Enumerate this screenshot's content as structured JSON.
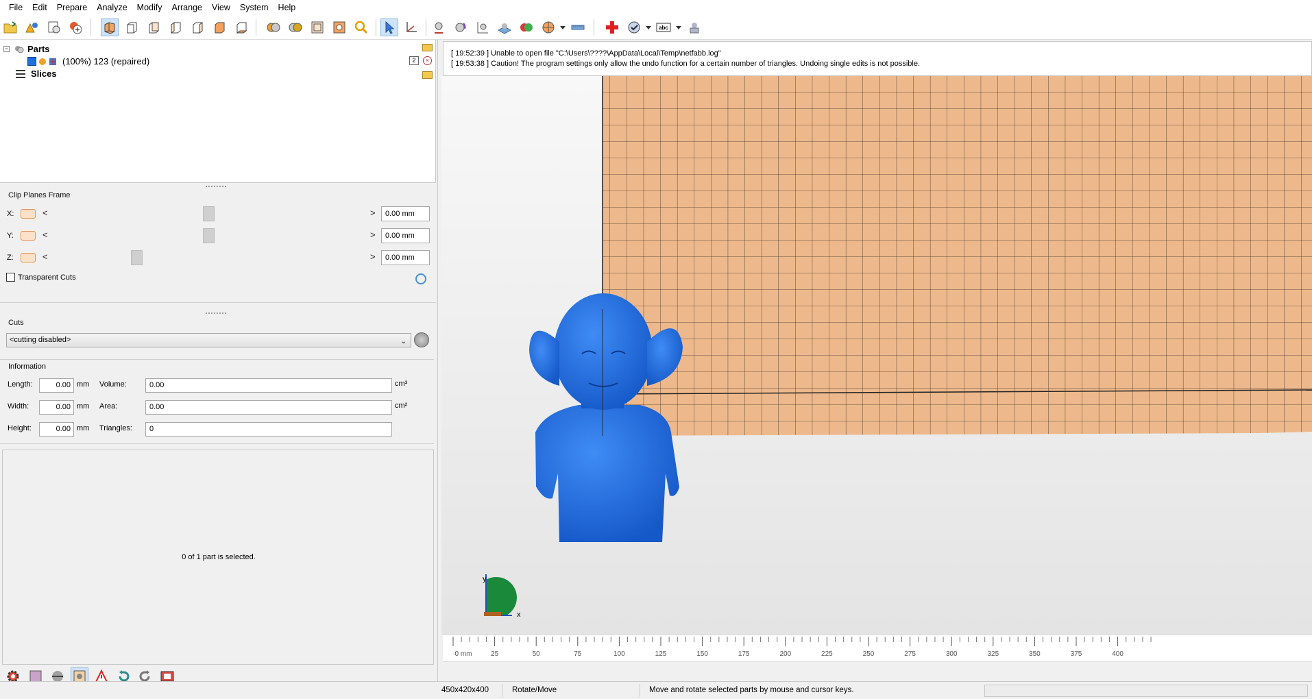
{
  "menu": [
    "File",
    "Edit",
    "Prepare",
    "Analyze",
    "Modify",
    "Arrange",
    "View",
    "System",
    "Help"
  ],
  "tree": {
    "parts_label": "Parts",
    "part_item_label": "(100%) 123 (repaired)",
    "part_count": "2",
    "slices_label": "Slices"
  },
  "clip_planes": {
    "title": "Clip Planes Frame",
    "rows": [
      {
        "axis": "X:",
        "value": "0.00 mm",
        "position": 0.5
      },
      {
        "axis": "Y:",
        "value": "0.00 mm",
        "position": 0.5
      },
      {
        "axis": "Z:",
        "value": "0.00 mm",
        "position": 0.27
      }
    ],
    "transparent_cuts_label": "Transparent Cuts",
    "transparent_cuts_checked": false
  },
  "cuts": {
    "title": "Cuts",
    "selected": "<cutting disabled>"
  },
  "information": {
    "title": "Information",
    "length_label": "Length:",
    "length_value": "0.00",
    "width_label": "Width:",
    "width_value": "0.00",
    "height_label": "Height:",
    "height_value": "0.00",
    "unit_mm": "mm",
    "volume_label": "Volume:",
    "volume_value": "0.00",
    "area_label": "Area:",
    "area_value": "0.00",
    "triangles_label": "Triangles:",
    "triangles_value": "0",
    "unit_cm3": "cm³",
    "unit_cm2": "cm²"
  },
  "selection_text": "0 of 1 part is selected.",
  "log": [
    "[ 19:52:39 ] Unable to open file \"C:\\Users\\????\\AppData\\Local\\Temp\\netfabb.log\"",
    "[ 19:53:38 ] Caution! The program settings only allow the undo function for a certain number of triangles. Undoing single edits is not possible."
  ],
  "axes": {
    "x_label": "x",
    "y_label": "y"
  },
  "ruler": {
    "labels": [
      "0 mm",
      "25",
      "50",
      "75",
      "100",
      "125",
      "150",
      "175",
      "200",
      "225",
      "250",
      "275",
      "300",
      "325",
      "350",
      "375",
      "400"
    ]
  },
  "status": {
    "dimensions": "450x420x400",
    "mode": "Rotate/Move",
    "hint": "Move and rotate selected parts by mouse and cursor keys."
  },
  "colors": {
    "platform": "#edb98c",
    "model": "#1f6fe0",
    "accent_orange": "#e8904a"
  },
  "icons": {
    "toolbar": [
      "open-project-icon",
      "add-part-icon",
      "new-analysis-icon",
      "add-shell-icon",
      "view-perspective-icon",
      "view-front-icon",
      "view-back-icon",
      "view-left-icon",
      "view-right-icon",
      "view-top-icon",
      "view-bottom-icon",
      "render-a-icon",
      "render-b-icon",
      "zoom-fit-icon",
      "zoom-parts-icon",
      "zoom-magnify-icon",
      "select-cursor-icon",
      "rotate-axes-icon",
      "move-tool-icon",
      "rotate-tool-icon",
      "scale-tool-icon",
      "platform-icon",
      "merge-color-icon",
      "color-wheel-icon",
      "ruler-icon",
      "repair-cross-icon",
      "view-options-icon",
      "label-abc-icon",
      "slice-tool-icon"
    ]
  }
}
